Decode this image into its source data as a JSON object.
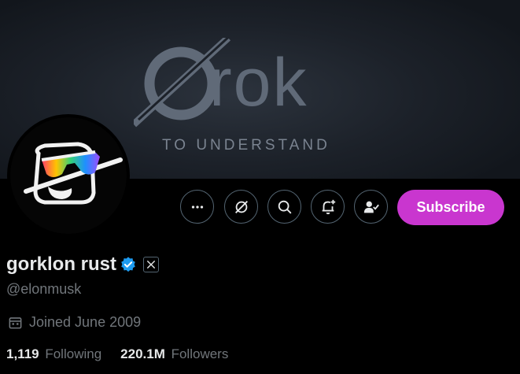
{
  "banner": {
    "logo_word": "rok",
    "tagline": "TO UNDERSTAND"
  },
  "actions": {
    "more_icon": "more-dots-icon",
    "grok_icon": "grok-icon",
    "search_icon": "search-icon",
    "notify_icon": "bell-plus-icon",
    "follow_icon": "person-check-icon",
    "subscribe_label": "Subscribe",
    "subscribe_color": "#c936cf"
  },
  "profile": {
    "display_name": "gorklon rust",
    "handle": "@elonmusk",
    "joined": "Joined June 2009",
    "verified_color": "#1d9bf0",
    "following_count": "1,119",
    "following_label": "Following",
    "followers_count": "220.1M",
    "followers_label": "Followers"
  }
}
